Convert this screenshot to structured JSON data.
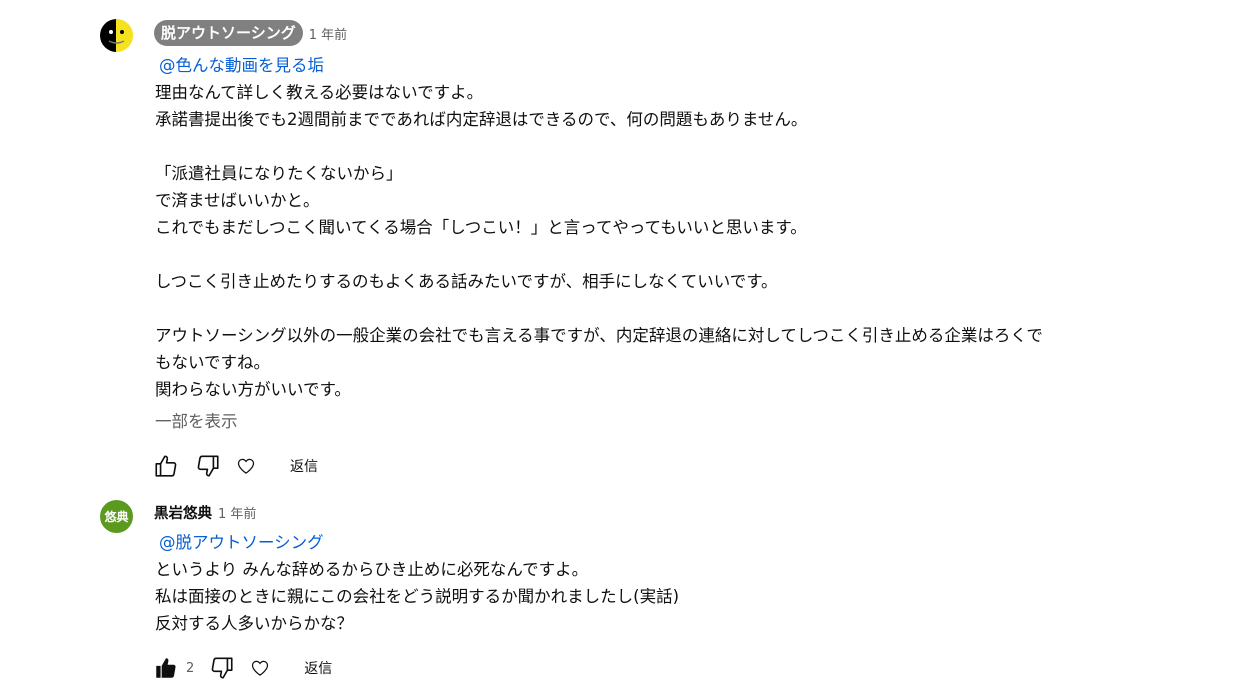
{
  "comments": [
    {
      "author": "脱アウトソーシング",
      "time": "1 年前",
      "mention": "@色んな動画を見る垢",
      "lines": [
        "理由なんて詳しく教える必要はないですよ。",
        "承諾書提出後でも2週間前までであれば内定辞退はできるので、何の問題もありません。",
        "",
        "「派遣社員になりたくないから」",
        "で済ませばいいかと。",
        "これでもまだしつこく聞いてくる場合「しつこい！」と言ってやってもいいと思います。",
        "",
        "しつこく引き止めたりするのもよくある話みたいですが、相手にしなくていいです。",
        "",
        "アウトソーシング以外の一般企業の会社でも言える事ですが、内定辞退の連絡に対してしつこく引き止める企業はろくで",
        "もないですね。",
        "関わらない方がいいです。"
      ],
      "show_more": "一部を表示",
      "reply_label": "返信",
      "like_count": ""
    },
    {
      "author": "黒岩悠典",
      "avatar_initials": "悠典",
      "avatar_color": "#5b9a1f",
      "time": "1 年前",
      "mention": "@脱アウトソーシング",
      "lines": [
        "というより みんな辞めるからひき止めに必死なんですよ。",
        "私は面接のときに親にこの会社をどう説明するか聞かれましたし(実話)",
        "反対する人多いからかな？"
      ],
      "reply_label": "返信",
      "like_count": "2"
    }
  ],
  "icons": {
    "like": "thumbs-up-icon",
    "dislike": "thumbs-down-icon",
    "heart": "heart-icon"
  },
  "colors": {
    "mention": "#065fd4",
    "owner_badge": "#808080",
    "secondary_text": "#606060"
  }
}
